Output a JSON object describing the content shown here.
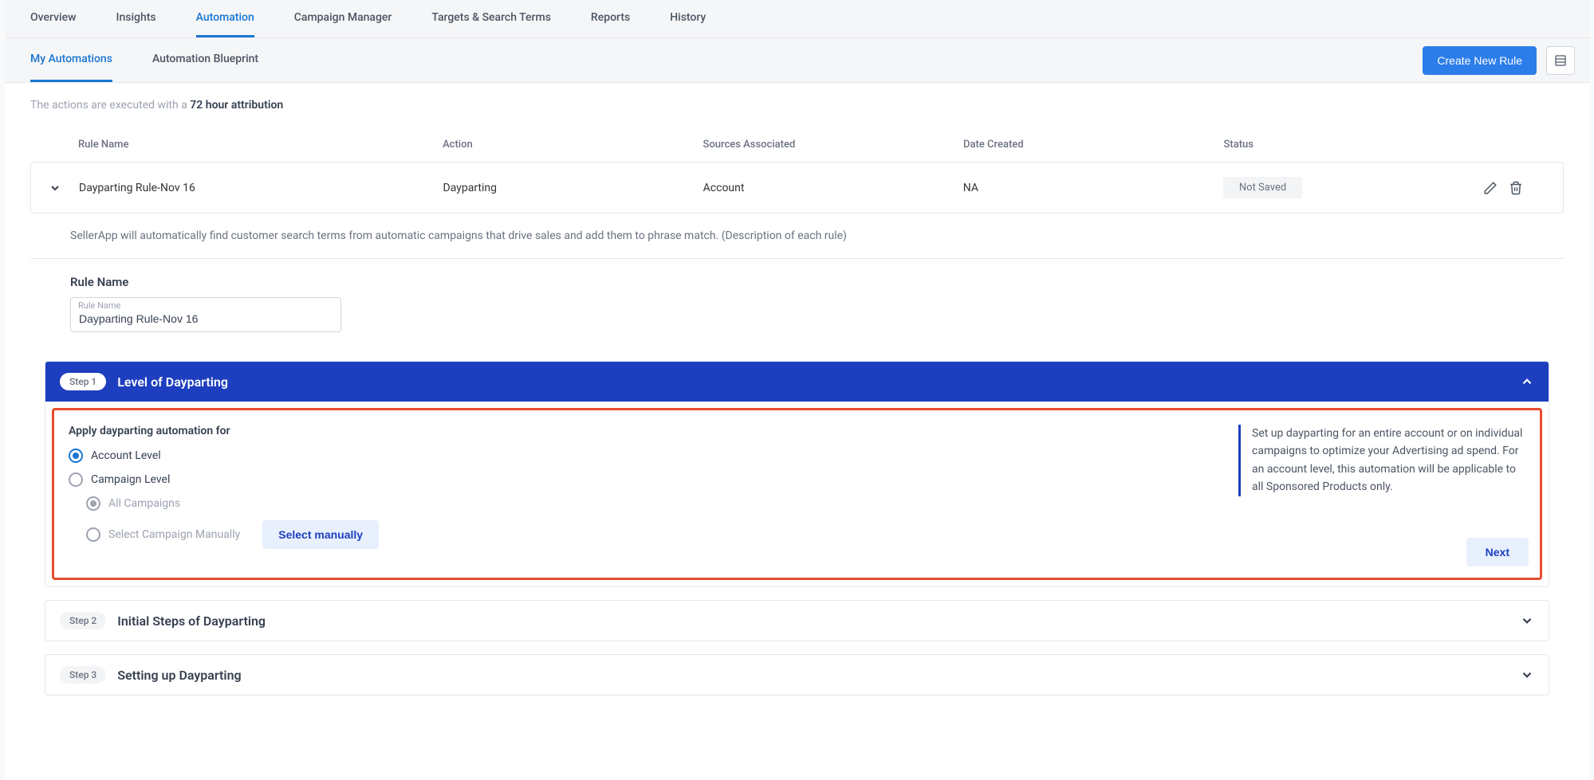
{
  "topTabs": [
    "Overview",
    "Insights",
    "Automation",
    "Campaign Manager",
    "Targets & Search Terms",
    "Reports",
    "History"
  ],
  "topTabActive": 2,
  "subTabs": [
    "My Automations",
    "Automation Blueprint"
  ],
  "subTabActive": 0,
  "createButton": "Create New Rule",
  "attribution": {
    "prefix": "The actions are executed with a ",
    "bold": "72 hour attribution"
  },
  "table": {
    "headers": [
      "Rule Name",
      "Action",
      "Sources Associated",
      "Date Created",
      "Status"
    ],
    "row": {
      "ruleName": "Dayparting Rule-Nov 16",
      "action": "Dayparting",
      "sources": "Account",
      "dateCreated": "NA",
      "status": "Not Saved"
    }
  },
  "ruleDescription": "SellerApp will automatically find customer search terms from automatic campaigns that drive sales and add them to phrase match. (Description of each rule)",
  "ruleNameSection": {
    "heading": "Rule Name",
    "floatLabel": "Rule Name",
    "value": "Dayparting Rule-Nov 16"
  },
  "step1": {
    "chip": "Step 1",
    "title": "Level of Dayparting",
    "formHeading": "Apply dayparting automation for",
    "options": {
      "account": "Account Level",
      "campaign": "Campaign Level",
      "allCampaigns": "All Campaigns",
      "selectManually": "Select Campaign Manually",
      "selectButton": "Select manually"
    },
    "info": "Set up dayparting for an entire account or on individual campaigns to optimize your Advertising ad spend. For an account level, this automation will be applicable to all Sponsored Products only.",
    "next": "Next"
  },
  "step2": {
    "chip": "Step 2",
    "title": "Initial Steps of Dayparting"
  },
  "step3": {
    "chip": "Step 3",
    "title": "Setting up Dayparting"
  }
}
